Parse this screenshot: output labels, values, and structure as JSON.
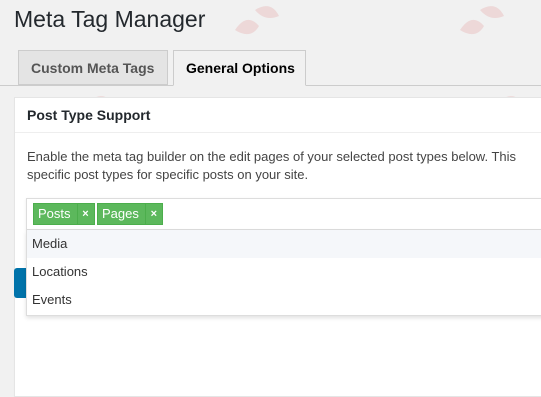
{
  "page": {
    "title": "Meta Tag Manager"
  },
  "tabs": [
    {
      "label": "Custom Meta Tags",
      "active": false
    },
    {
      "label": "General Options",
      "active": true
    }
  ],
  "section": {
    "title": "Post Type Support",
    "description": "Enable the meta tag builder on the edit pages of your selected post types below. This specific post types for specific posts on your site."
  },
  "post_type_select": {
    "selected": [
      {
        "label": "Posts",
        "remove": "×"
      },
      {
        "label": "Pages",
        "remove": "×"
      }
    ],
    "options": [
      {
        "label": "Media",
        "highlighted": true
      },
      {
        "label": "Locations",
        "highlighted": false
      },
      {
        "label": "Events",
        "highlighted": false
      }
    ]
  },
  "colors": {
    "chip": "#5cb85c",
    "primary_button": "#0073aa",
    "watermark": "#e8a9a9"
  }
}
